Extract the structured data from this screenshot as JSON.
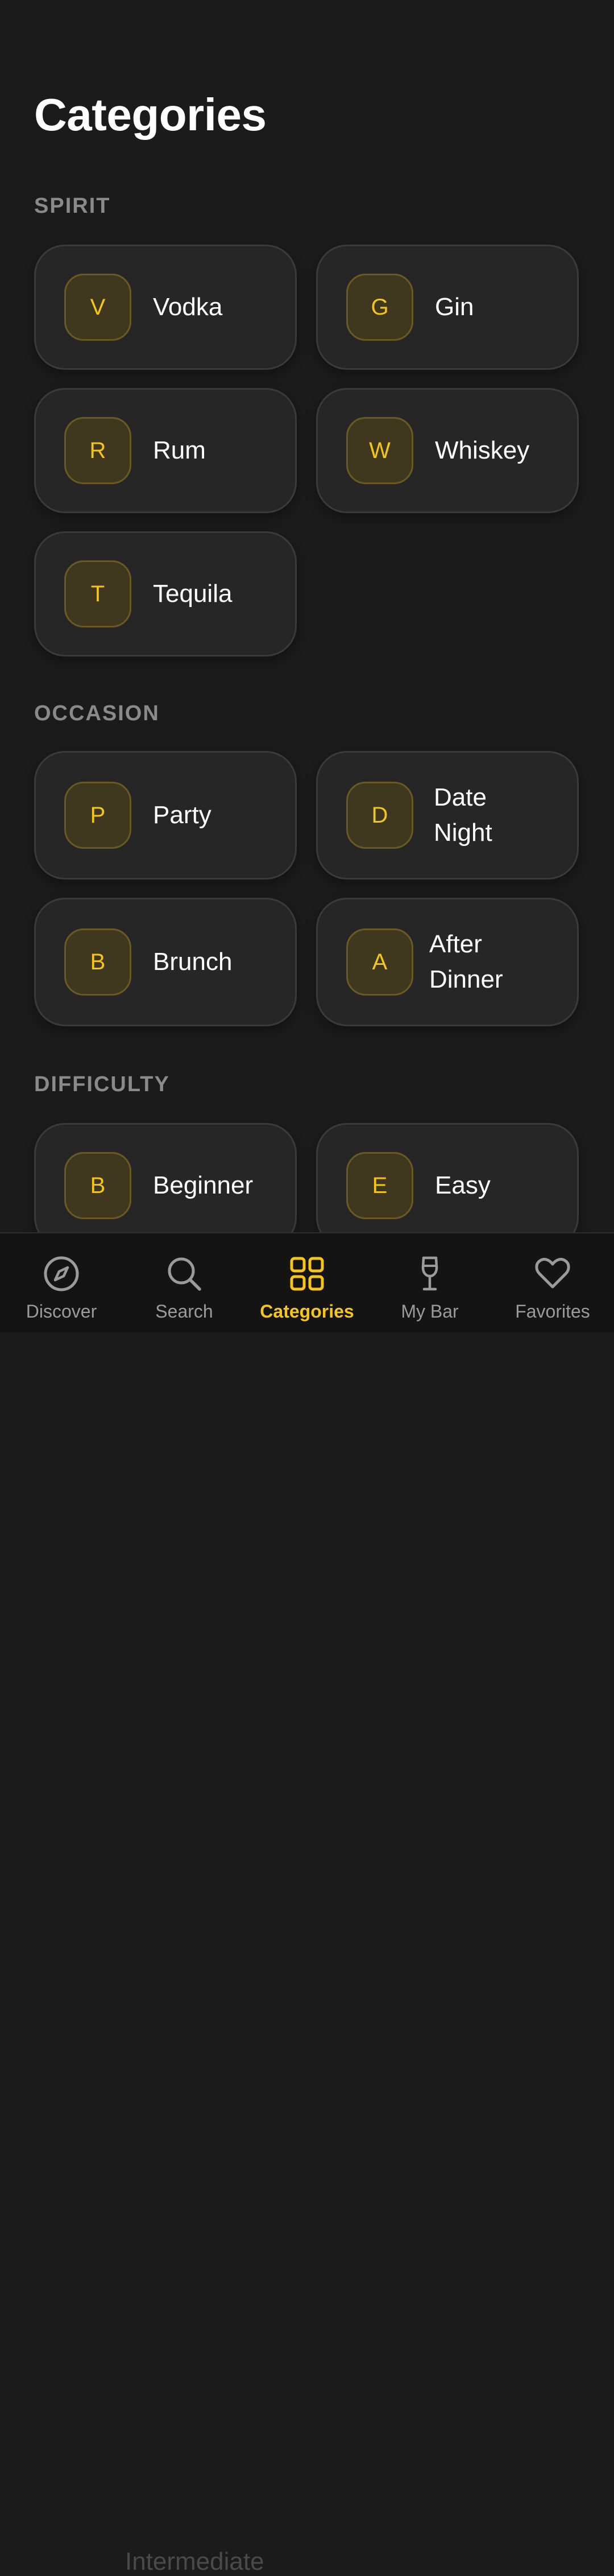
{
  "page": {
    "title": "Categories"
  },
  "sections": [
    {
      "label": "SPIRIT",
      "items": [
        {
          "letter": "V",
          "label": "Vodka"
        },
        {
          "letter": "G",
          "label": "Gin"
        },
        {
          "letter": "R",
          "label": "Rum"
        },
        {
          "letter": "W",
          "label": "Whiskey"
        },
        {
          "letter": "T",
          "label": "Tequila"
        }
      ]
    },
    {
      "label": "OCCASION",
      "items": [
        {
          "letter": "P",
          "label": "Party"
        },
        {
          "letter": "D",
          "label": "Date Night"
        },
        {
          "letter": "B",
          "label": "Brunch"
        },
        {
          "letter": "A",
          "label": "After Dinner"
        }
      ]
    },
    {
      "label": "DIFFICULTY",
      "items": [
        {
          "letter": "B",
          "label": "Beginner"
        },
        {
          "letter": "E",
          "label": "Easy"
        },
        {
          "letter": "",
          "label": "Intermediate"
        }
      ]
    }
  ],
  "nav": {
    "items": [
      {
        "label": "Discover",
        "icon": "compass-icon"
      },
      {
        "label": "Search",
        "icon": "search-icon"
      },
      {
        "label": "Categories",
        "icon": "grid-icon",
        "active": true
      },
      {
        "label": "My Bar",
        "icon": "wine-glass-icon"
      },
      {
        "label": "Favorites",
        "icon": "heart-icon"
      }
    ]
  },
  "colors": {
    "accent": "#f5c518",
    "background": "#1b1b1c",
    "card": "#262627"
  }
}
